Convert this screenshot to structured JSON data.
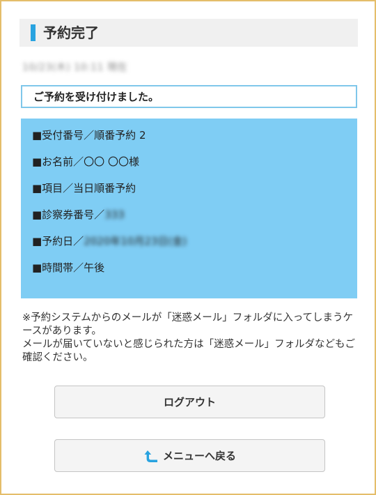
{
  "page": {
    "title": "予約完了",
    "timestamp": "10/23(木) 10:11 現在"
  },
  "confirmation": {
    "message": "ご予約を受け付けました。"
  },
  "details": {
    "reception_number": "■受付番号／順番予約 2",
    "name": "■お名前／〇〇 〇〇様",
    "item": "■項目／当日順番予約",
    "card_label": "■診察券番号／",
    "card_value": "333",
    "date_label": "■予約日／",
    "date_value": "2020年10月23日(金)",
    "time_slot": "■時間帯／午後"
  },
  "notice": {
    "line1": "※予約システムからのメールが「迷惑メール」フォルダに入ってしまうケースがあります。",
    "line2": "メールが届いていないと感じられた方は「迷惑メール」フォルダなどもご確認ください。"
  },
  "buttons": {
    "logout": "ログアウト",
    "back_to_menu": "メニューへ戻る"
  },
  "icons": {
    "back": "return-arrow-icon"
  },
  "colors": {
    "accent": "#29a3e0",
    "info_background": "#7fcdf4",
    "confirm_border": "#7fc7ea",
    "frame_border": "#e4bd6a",
    "title_background": "#f0f0f0"
  }
}
